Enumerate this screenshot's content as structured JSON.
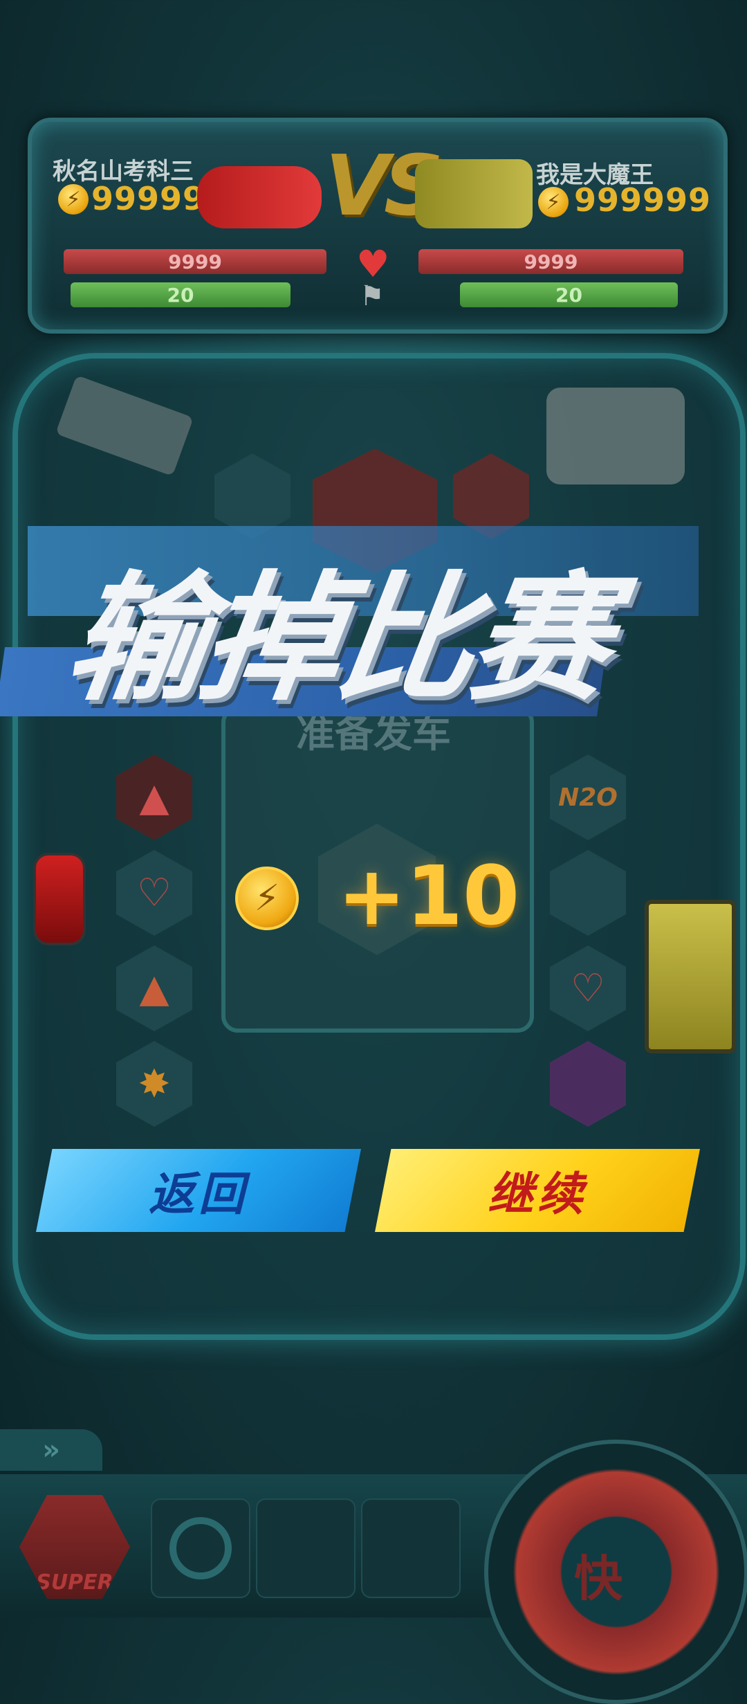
{
  "players": {
    "left": {
      "name": "秋名山考科三",
      "coins": "999999",
      "hp": "9999",
      "energy": "20"
    },
    "right": {
      "name": "我是大魔王",
      "coins": "999999",
      "hp": "9999",
      "energy": "20"
    }
  },
  "vs_label": "VS",
  "result": {
    "title": "输掉比赛",
    "status": "准备发车",
    "reward": "+10"
  },
  "buttons": {
    "back": "返回",
    "continue": "继续"
  },
  "hud": {
    "speed_label": "快",
    "super_label": "SUPER",
    "expand_icon": "chevrons-right-icon"
  },
  "board_items": {
    "left": [
      "gear-icon",
      "cone-icon",
      "heart-icon",
      "cone-icon",
      "bomb-icon"
    ],
    "right": [
      "wheel-icon",
      "nitro-icon",
      "hex-empty",
      "heart-icon",
      "box-icon"
    ]
  },
  "colors": {
    "accent_gold": "#ffc83a",
    "back_blue": "#22a6f0",
    "continue_yellow": "#ffd11a",
    "hp_red": "#c84a4a",
    "energy_green": "#6fbf5a"
  }
}
